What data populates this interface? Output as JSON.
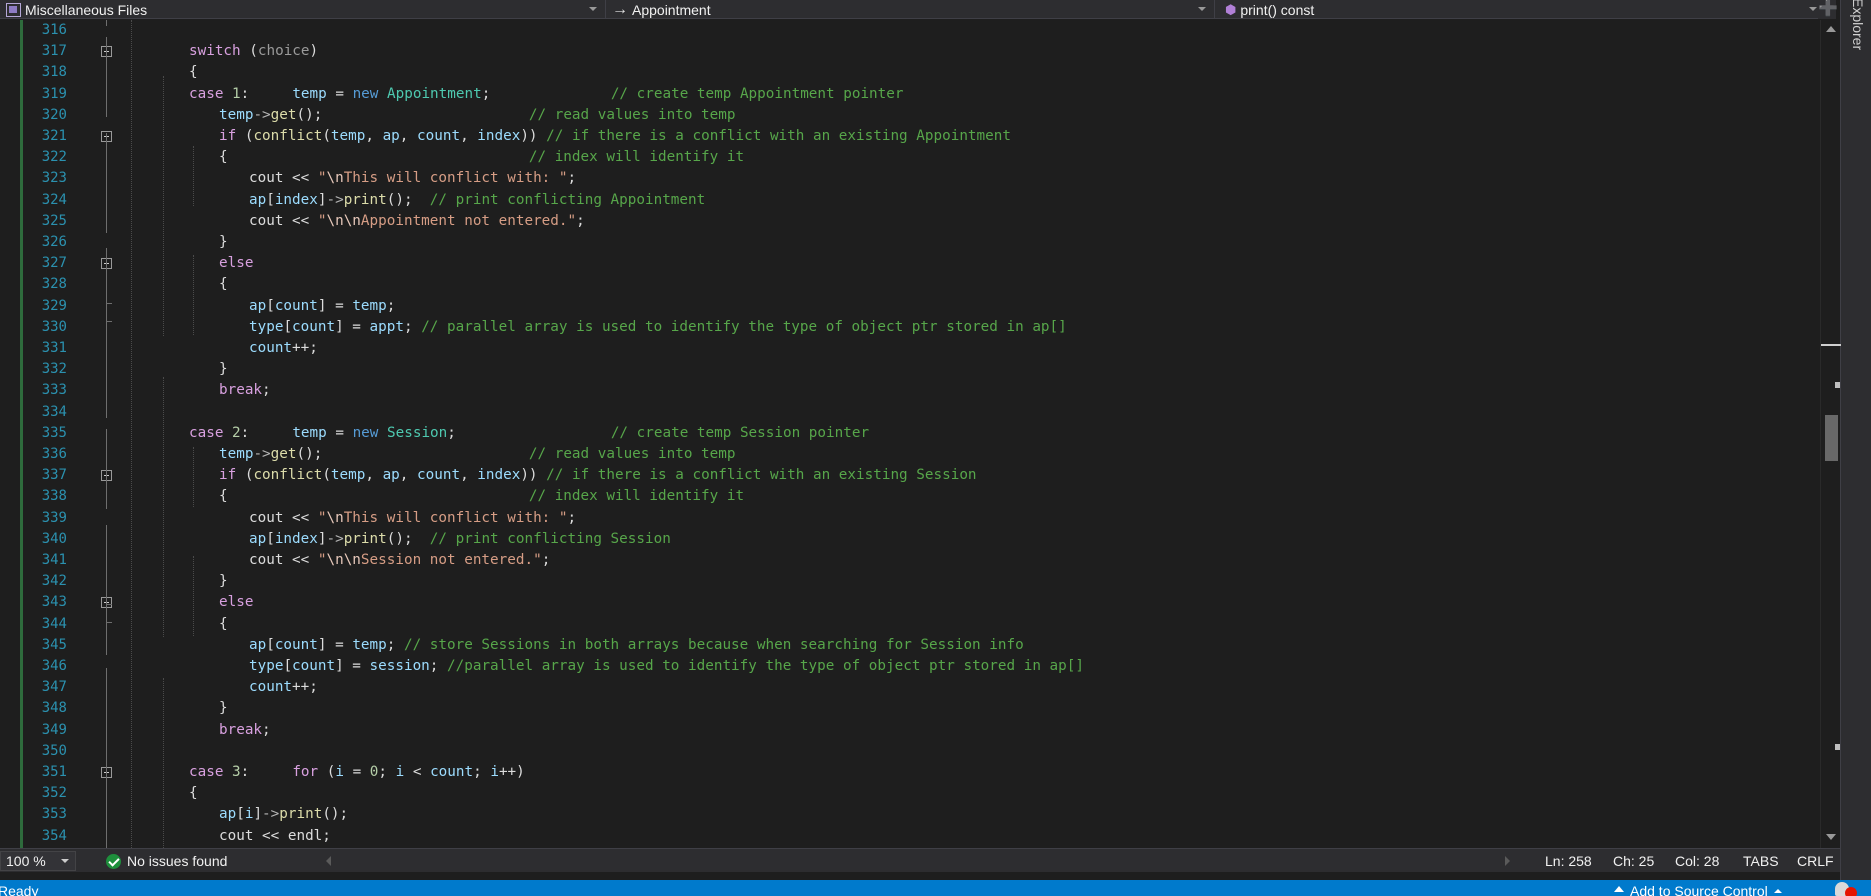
{
  "navbar": {
    "project": "Miscellaneous Files",
    "scope": "Appointment",
    "member": "print() const"
  },
  "side_tab": {
    "label": "Explorer"
  },
  "editor": {
    "lines": [
      {
        "n": "316",
        "indent": 0,
        "tokens": []
      },
      {
        "n": "317",
        "indent": 2,
        "tokens": [
          [
            "ctl",
            "switch"
          ],
          [
            "plain",
            " ("
          ],
          [
            "param",
            "choice"
          ],
          [
            "plain",
            ")"
          ]
        ]
      },
      {
        "n": "318",
        "indent": 2,
        "tokens": [
          [
            "plain",
            "{"
          ]
        ]
      },
      {
        "n": "319",
        "indent": 2,
        "tokens": [
          [
            "ctl",
            "case"
          ],
          [
            "plain",
            " "
          ],
          [
            "num",
            "1"
          ],
          [
            "plain",
            ":     "
          ],
          [
            "var",
            "temp"
          ],
          [
            "plain",
            " = "
          ],
          [
            "kw",
            "new"
          ],
          [
            "plain",
            " "
          ],
          [
            "type",
            "Appointment"
          ],
          [
            "plain",
            ";              "
          ],
          [
            "com",
            "// create temp Appointment pointer"
          ]
        ]
      },
      {
        "n": "320",
        "indent": 3,
        "tokens": [
          [
            "var",
            "temp"
          ],
          [
            "op",
            "->"
          ],
          [
            "fn",
            "get"
          ],
          [
            "plain",
            "();                        "
          ],
          [
            "com",
            "// read values into temp"
          ]
        ]
      },
      {
        "n": "321",
        "indent": 3,
        "tokens": [
          [
            "ctl",
            "if"
          ],
          [
            "plain",
            " ("
          ],
          [
            "fn",
            "conflict"
          ],
          [
            "plain",
            "("
          ],
          [
            "var",
            "temp"
          ],
          [
            "plain",
            ", "
          ],
          [
            "var",
            "ap"
          ],
          [
            "plain",
            ", "
          ],
          [
            "var",
            "count"
          ],
          [
            "plain",
            ", "
          ],
          [
            "var",
            "index"
          ],
          [
            "plain",
            ")) "
          ],
          [
            "com",
            "// if there is a conflict with an existing Appointment"
          ]
        ]
      },
      {
        "n": "322",
        "indent": 3,
        "tokens": [
          [
            "plain",
            "{                                   "
          ],
          [
            "com",
            "// index will identify it"
          ]
        ]
      },
      {
        "n": "323",
        "indent": 4,
        "tokens": [
          [
            "plain",
            "cout << "
          ],
          [
            "str",
            "\""
          ],
          [
            "esc",
            "\\n"
          ],
          [
            "str",
            "This will conflict with: \""
          ],
          [
            "plain",
            ";"
          ]
        ]
      },
      {
        "n": "324",
        "indent": 4,
        "tokens": [
          [
            "var",
            "ap"
          ],
          [
            "plain",
            "["
          ],
          [
            "var",
            "index"
          ],
          [
            "plain",
            "]"
          ],
          [
            "op",
            "->"
          ],
          [
            "fn",
            "print"
          ],
          [
            "plain",
            "();  "
          ],
          [
            "com",
            "// print conflicting Appointment"
          ]
        ]
      },
      {
        "n": "325",
        "indent": 4,
        "tokens": [
          [
            "plain",
            "cout << "
          ],
          [
            "str",
            "\""
          ],
          [
            "esc",
            "\\n\\n"
          ],
          [
            "str",
            "Appointment not entered.\""
          ],
          [
            "plain",
            ";"
          ]
        ]
      },
      {
        "n": "326",
        "indent": 3,
        "tokens": [
          [
            "plain",
            "}"
          ]
        ]
      },
      {
        "n": "327",
        "indent": 3,
        "tokens": [
          [
            "ctl",
            "else"
          ]
        ]
      },
      {
        "n": "328",
        "indent": 3,
        "tokens": [
          [
            "plain",
            "{"
          ]
        ]
      },
      {
        "n": "329",
        "indent": 4,
        "tokens": [
          [
            "var",
            "ap"
          ],
          [
            "plain",
            "["
          ],
          [
            "var",
            "count"
          ],
          [
            "plain",
            "] = "
          ],
          [
            "var",
            "temp"
          ],
          [
            "plain",
            ";"
          ]
        ]
      },
      {
        "n": "330",
        "indent": 4,
        "tokens": [
          [
            "var",
            "type"
          ],
          [
            "plain",
            "["
          ],
          [
            "var",
            "count"
          ],
          [
            "plain",
            "] = "
          ],
          [
            "var",
            "appt"
          ],
          [
            "plain",
            "; "
          ],
          [
            "com",
            "// parallel array is used to identify the type of object ptr stored in ap[]"
          ]
        ]
      },
      {
        "n": "331",
        "indent": 4,
        "tokens": [
          [
            "var",
            "count"
          ],
          [
            "plain",
            "++;"
          ]
        ]
      },
      {
        "n": "332",
        "indent": 3,
        "tokens": [
          [
            "plain",
            "}"
          ]
        ]
      },
      {
        "n": "333",
        "indent": 3,
        "tokens": [
          [
            "ctl",
            "break"
          ],
          [
            "plain",
            ";"
          ]
        ]
      },
      {
        "n": "334",
        "indent": 0,
        "tokens": []
      },
      {
        "n": "335",
        "indent": 2,
        "tokens": [
          [
            "ctl",
            "case"
          ],
          [
            "plain",
            " "
          ],
          [
            "num",
            "2"
          ],
          [
            "plain",
            ":     "
          ],
          [
            "var",
            "temp"
          ],
          [
            "plain",
            " = "
          ],
          [
            "kw",
            "new"
          ],
          [
            "plain",
            " "
          ],
          [
            "type",
            "Session"
          ],
          [
            "plain",
            ";                  "
          ],
          [
            "com",
            "// create temp Session pointer"
          ]
        ]
      },
      {
        "n": "336",
        "indent": 3,
        "tokens": [
          [
            "var",
            "temp"
          ],
          [
            "op",
            "->"
          ],
          [
            "fn",
            "get"
          ],
          [
            "plain",
            "();                        "
          ],
          [
            "com",
            "// read values into temp"
          ]
        ]
      },
      {
        "n": "337",
        "indent": 3,
        "tokens": [
          [
            "ctl",
            "if"
          ],
          [
            "plain",
            " ("
          ],
          [
            "fn",
            "conflict"
          ],
          [
            "plain",
            "("
          ],
          [
            "var",
            "temp"
          ],
          [
            "plain",
            ", "
          ],
          [
            "var",
            "ap"
          ],
          [
            "plain",
            ", "
          ],
          [
            "var",
            "count"
          ],
          [
            "plain",
            ", "
          ],
          [
            "var",
            "index"
          ],
          [
            "plain",
            ")) "
          ],
          [
            "com",
            "// if there is a conflict with an existing Session"
          ]
        ]
      },
      {
        "n": "338",
        "indent": 3,
        "tokens": [
          [
            "plain",
            "{                                   "
          ],
          [
            "com",
            "// index will identify it"
          ]
        ]
      },
      {
        "n": "339",
        "indent": 4,
        "tokens": [
          [
            "plain",
            "cout << "
          ],
          [
            "str",
            "\""
          ],
          [
            "esc",
            "\\n"
          ],
          [
            "str",
            "This will conflict with: \""
          ],
          [
            "plain",
            ";"
          ]
        ]
      },
      {
        "n": "340",
        "indent": 4,
        "tokens": [
          [
            "var",
            "ap"
          ],
          [
            "plain",
            "["
          ],
          [
            "var",
            "index"
          ],
          [
            "plain",
            "]"
          ],
          [
            "op",
            "->"
          ],
          [
            "fn",
            "print"
          ],
          [
            "plain",
            "();  "
          ],
          [
            "com",
            "// print conflicting Session"
          ]
        ]
      },
      {
        "n": "341",
        "indent": 4,
        "tokens": [
          [
            "plain",
            "cout << "
          ],
          [
            "str",
            "\""
          ],
          [
            "esc",
            "\\n\\n"
          ],
          [
            "str",
            "Session not entered.\""
          ],
          [
            "plain",
            ";"
          ]
        ]
      },
      {
        "n": "342",
        "indent": 3,
        "tokens": [
          [
            "plain",
            "}"
          ]
        ]
      },
      {
        "n": "343",
        "indent": 3,
        "tokens": [
          [
            "ctl",
            "else"
          ]
        ]
      },
      {
        "n": "344",
        "indent": 3,
        "tokens": [
          [
            "plain",
            "{"
          ]
        ]
      },
      {
        "n": "345",
        "indent": 4,
        "tokens": [
          [
            "var",
            "ap"
          ],
          [
            "plain",
            "["
          ],
          [
            "var",
            "count"
          ],
          [
            "plain",
            "] = "
          ],
          [
            "var",
            "temp"
          ],
          [
            "plain",
            "; "
          ],
          [
            "com",
            "// store Sessions in both arrays because when searching for Session info"
          ]
        ]
      },
      {
        "n": "346",
        "indent": 4,
        "tokens": [
          [
            "var",
            "type"
          ],
          [
            "plain",
            "["
          ],
          [
            "var",
            "count"
          ],
          [
            "plain",
            "] = "
          ],
          [
            "var",
            "session"
          ],
          [
            "plain",
            "; "
          ],
          [
            "com",
            "//parallel array is used to identify the type of object ptr stored in ap[]"
          ]
        ]
      },
      {
        "n": "347",
        "indent": 4,
        "tokens": [
          [
            "var",
            "count"
          ],
          [
            "plain",
            "++;"
          ]
        ]
      },
      {
        "n": "348",
        "indent": 3,
        "tokens": [
          [
            "plain",
            "}"
          ]
        ]
      },
      {
        "n": "349",
        "indent": 3,
        "tokens": [
          [
            "ctl",
            "break"
          ],
          [
            "plain",
            ";"
          ]
        ]
      },
      {
        "n": "350",
        "indent": 0,
        "tokens": []
      },
      {
        "n": "351",
        "indent": 2,
        "tokens": [
          [
            "ctl",
            "case"
          ],
          [
            "plain",
            " "
          ],
          [
            "num",
            "3"
          ],
          [
            "plain",
            ":     "
          ],
          [
            "ctl",
            "for"
          ],
          [
            "plain",
            " ("
          ],
          [
            "var",
            "i"
          ],
          [
            "plain",
            " = "
          ],
          [
            "num",
            "0"
          ],
          [
            "plain",
            "; "
          ],
          [
            "var",
            "i"
          ],
          [
            "plain",
            " < "
          ],
          [
            "var",
            "count"
          ],
          [
            "plain",
            "; "
          ],
          [
            "var",
            "i"
          ],
          [
            "plain",
            "++)"
          ]
        ]
      },
      {
        "n": "352",
        "indent": 2,
        "tokens": [
          [
            "plain",
            "{"
          ]
        ]
      },
      {
        "n": "353",
        "indent": 3,
        "tokens": [
          [
            "var",
            "ap"
          ],
          [
            "plain",
            "["
          ],
          [
            "var",
            "i"
          ],
          [
            "plain",
            "]"
          ],
          [
            "op",
            "->"
          ],
          [
            "fn",
            "print"
          ],
          [
            "plain",
            "();"
          ]
        ]
      },
      {
        "n": "354",
        "indent": 3,
        "tokens": [
          [
            "plain",
            "cout << endl;"
          ]
        ]
      }
    ],
    "folds": [
      "317",
      "321",
      "327",
      "337",
      "343",
      "351"
    ]
  },
  "editor_status": {
    "zoom": "100 %",
    "issues": "No issues found",
    "ln": "Ln: 258",
    "ch": "Ch: 25",
    "col": "Col: 28",
    "tabs": "TABS",
    "eol": "CRLF"
  },
  "statusbar": {
    "ready": "Ready",
    "source_control": "Add to Source Control"
  },
  "colors": {
    "background": "#1e1e1e",
    "line_number": "#2b91af",
    "keyword": "#569cd6",
    "control": "#d8a0df",
    "type": "#4ec9b0",
    "variable": "#9cdcfe",
    "function": "#dcdcaa",
    "string": "#d69d85",
    "comment": "#57a64a",
    "status_blue": "#007acc"
  }
}
